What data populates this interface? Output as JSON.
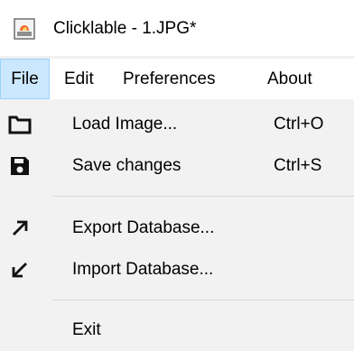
{
  "window": {
    "title": "Clicklable - 1.JPG*",
    "icon": "clicklable-app-icon"
  },
  "menubar": {
    "items": [
      {
        "label": "File",
        "active": true
      },
      {
        "label": "Edit",
        "active": false
      },
      {
        "label": "Preferences",
        "active": false
      },
      {
        "label": "About",
        "active": false
      }
    ]
  },
  "file_menu": {
    "items": [
      {
        "label": "Load Image...",
        "shortcut": "Ctrl+O",
        "icon": "folder-icon"
      },
      {
        "label": "Save changes",
        "shortcut": "Ctrl+S",
        "icon": "floppy-disk-icon"
      },
      {
        "label": "Export Database...",
        "shortcut": "",
        "icon": "arrow-up-right-icon"
      },
      {
        "label": "Import Database...",
        "shortcut": "",
        "icon": "arrow-down-left-icon"
      },
      {
        "label": "Exit",
        "shortcut": "",
        "icon": ""
      }
    ]
  },
  "colors": {
    "active_menu_background": "#cce8ff",
    "active_menu_border": "#99d1ff",
    "menu_background": "#f2f2f2"
  }
}
